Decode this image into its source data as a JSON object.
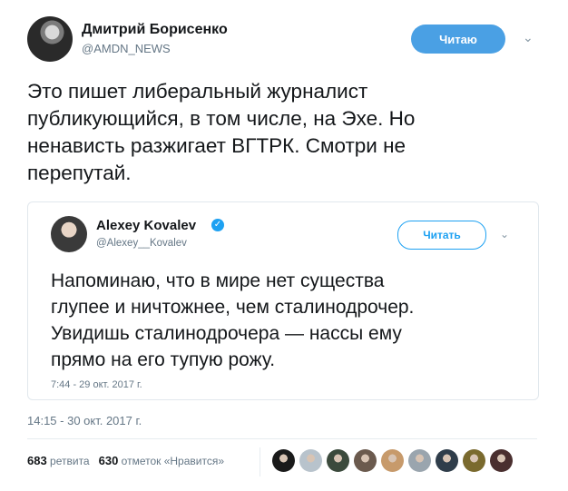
{
  "author": {
    "name": "Дмитрий Борисенко",
    "handle": "@AMDN_NEWS",
    "follow_label": "Читаю"
  },
  "tweet": {
    "text": "Это пишет либеральный журналист\nпубликующийся, в том числе, на Эхе. Но\nненависть разжигает ВГТРК. Смотри не\nперепутай.",
    "timestamp": "14:15 - 30 окт. 2017 г."
  },
  "quoted": {
    "name": "Alexey Kovalev",
    "handle": "@Alexey__Kovalev",
    "follow_label": "Читать",
    "verified_icon": "✓",
    "text": "Напоминаю, что в мире нет существа\nглупее и ничтожнее, чем сталинодрочер.\nУвидишь сталинодрочера — нассы ему\nпрямо на его тупую рожу.",
    "timestamp": "7:44 - 29 окт. 2017 г."
  },
  "stats": {
    "retweets_count": "683",
    "retweets_label": "ретвита",
    "likes_count": "630",
    "likes_label": "отметок «Нравится»"
  },
  "likers": [
    {
      "color": "#1a1a1a"
    },
    {
      "color": "#b8c3cc"
    },
    {
      "color": "#3b4a3c"
    },
    {
      "color": "#6b5a4e"
    },
    {
      "color": "#c79a6b"
    },
    {
      "color": "#9aa5ae"
    },
    {
      "color": "#2f3d4a"
    },
    {
      "color": "#7a6a2e"
    },
    {
      "color": "#4a2f2f"
    }
  ],
  "colors": {
    "accent": "#1da1f2",
    "follow_button": "#4aa0e4",
    "muted": "#657786"
  }
}
